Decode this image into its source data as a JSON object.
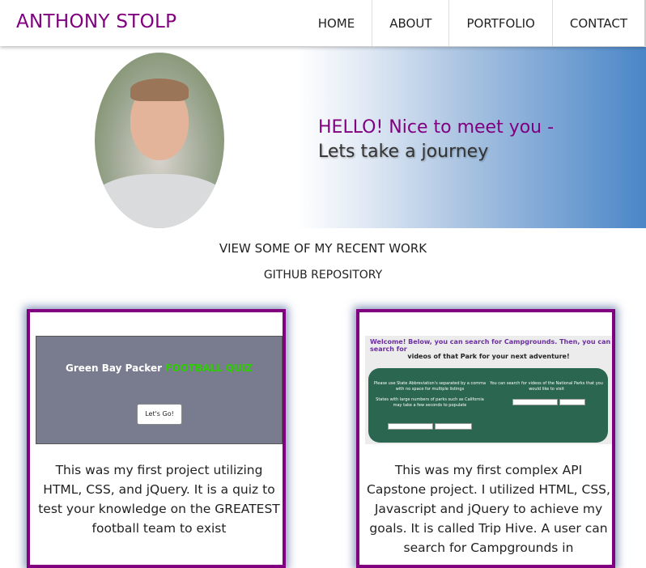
{
  "nav": {
    "brand": "ANTHONY STOLP",
    "items": [
      "HOME",
      "ABOUT",
      "PORTFOLIO",
      "CONTACT"
    ]
  },
  "hero": {
    "greeting": "HELLO! Nice to meet you -",
    "tagline": "Lets take a journey"
  },
  "links": {
    "recent_work": "VIEW SOME OF MY RECENT WORK",
    "github": "GITHUB REPOSITORY"
  },
  "projects": [
    {
      "thumb_title_plain": "Green Bay Packer ",
      "thumb_title_accent": "FOOTBALL QUIZ",
      "thumb_button": "Let's Go!",
      "description": "This was my first project utilizing HTML, CSS, and jQuery. It is a quiz to test your knowledge on the GREATEST football team to exist"
    },
    {
      "thumb_welcome": "Welcome!",
      "thumb_intro": " Below, you can search for Campgrounds. Then, you can search for",
      "thumb_intro2": "videos of that Park for your next adventure!",
      "thumb_left_text": "Please use State Abbreviation's separated by a comma with no space for multiple listings",
      "thumb_left_text2": "States with large numbers of parks such as California may take a few seconds to populate",
      "thumb_right_text": "You can search for videos of the National Parks that you would like to visit",
      "description": "This was my first complex API Capstone project. I utilized HTML, CSS, Javascript and jQuery to achieve my goals. It is called Trip Hive. A user can search for Campgrounds in"
    }
  ],
  "colors": {
    "brand": "#800080",
    "hero_gradient_end": "#4a86c8",
    "card_border": "#800080"
  }
}
